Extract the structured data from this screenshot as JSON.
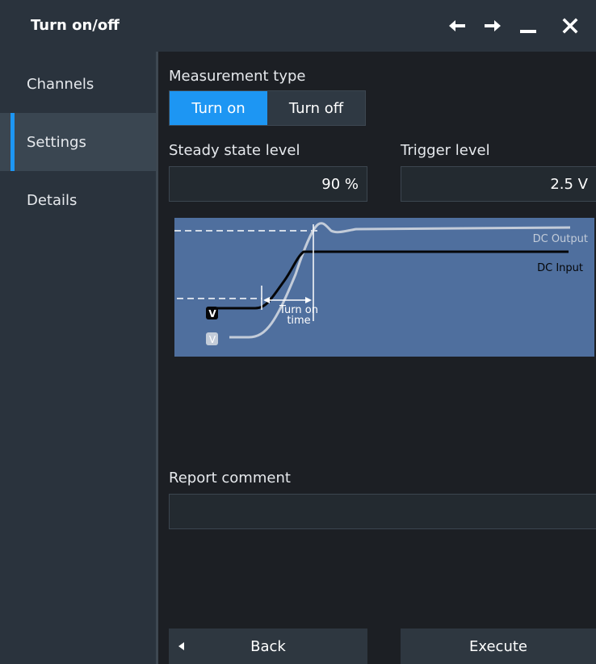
{
  "window": {
    "title": "Turn on/off"
  },
  "titlebar_icons": [
    "arrow-left-icon",
    "arrow-right-icon",
    "minimize-icon",
    "close-icon"
  ],
  "sidebar": {
    "items": [
      {
        "label": "Channels",
        "active": false
      },
      {
        "label": "Settings",
        "active": true
      },
      {
        "label": "Details",
        "active": false
      }
    ]
  },
  "settings": {
    "measurement_type_label": "Measurement type",
    "measurement_type_options": [
      "Turn on",
      "Turn off"
    ],
    "measurement_type_selected": "Turn on",
    "steady_state_label": "Steady state level",
    "steady_state_value": "90 %",
    "trigger_label": "Trigger level",
    "trigger_value": "2.5 V",
    "report_comment_label": "Report comment",
    "report_comment_value": ""
  },
  "diagram": {
    "output_label": "DC Output",
    "input_label": "DC Input",
    "time_label_line1": "Turn on",
    "time_label_line2": "time",
    "badge_input": "V",
    "badge_output": "V"
  },
  "footer": {
    "back_label": "Back",
    "execute_label": "Execute"
  },
  "colors": {
    "accent": "#1d96f3",
    "sidebar": "#2a333d",
    "background": "#1c1f24",
    "diagram_bg": "#4f6f9e"
  }
}
